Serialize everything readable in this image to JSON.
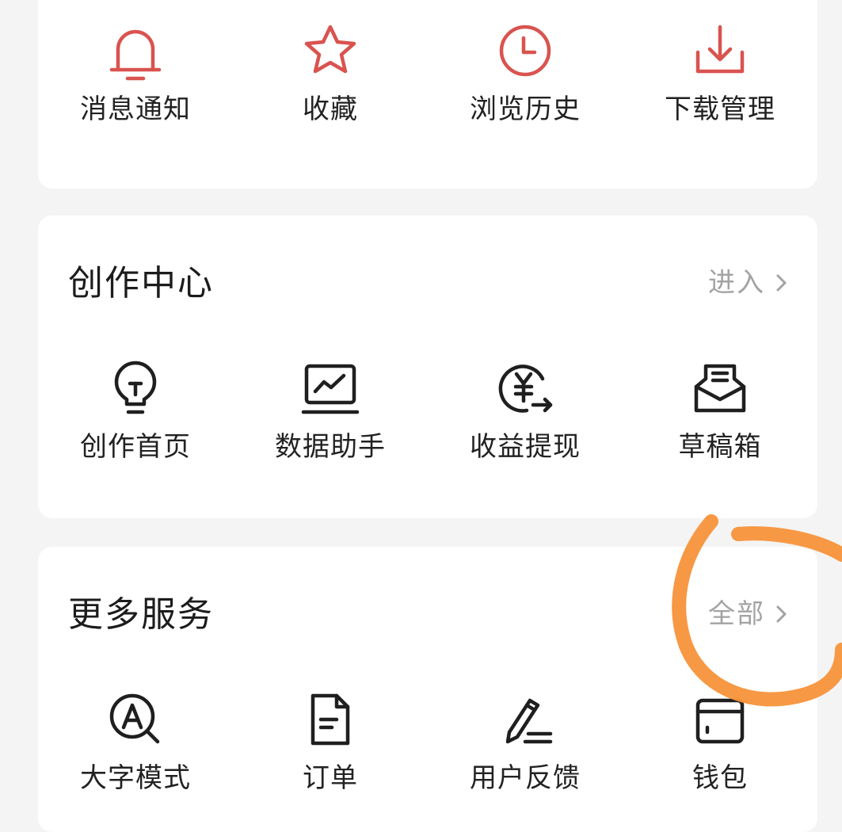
{
  "colors": {
    "accent_red": "#d9534f",
    "icon_dark": "#1f1f1f",
    "link_gray": "#a3a3a3",
    "annotation_orange": "#f7923a"
  },
  "quick_actions": [
    {
      "label": "消息通知",
      "icon": "bell-icon"
    },
    {
      "label": "收藏",
      "icon": "star-icon"
    },
    {
      "label": "浏览历史",
      "icon": "clock-icon"
    },
    {
      "label": "下载管理",
      "icon": "download-icon"
    }
  ],
  "creation_center": {
    "title": "创作中心",
    "link_label": "进入",
    "items": [
      {
        "label": "创作首页",
        "icon": "lightbulb-icon"
      },
      {
        "label": "数据助手",
        "icon": "chart-monitor-icon"
      },
      {
        "label": "收益提现",
        "icon": "yuan-withdraw-icon"
      },
      {
        "label": "草稿箱",
        "icon": "draft-box-icon"
      }
    ]
  },
  "more_services": {
    "title": "更多服务",
    "link_label": "全部",
    "items": [
      {
        "label": "大字模式",
        "icon": "large-font-icon"
      },
      {
        "label": "订单",
        "icon": "order-document-icon"
      },
      {
        "label": "用户反馈",
        "icon": "pencil-feedback-icon"
      },
      {
        "label": "钱包",
        "icon": "wallet-icon"
      }
    ]
  }
}
